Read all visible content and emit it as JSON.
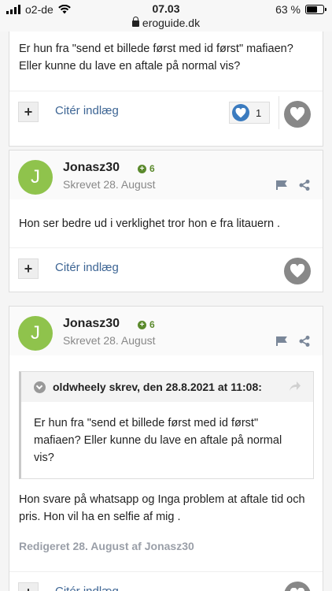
{
  "status_bar": {
    "carrier": "o2-de",
    "time": "07.03",
    "url": "eroguide.dk",
    "battery": "63 %",
    "battery_level": 0.63
  },
  "posts": [
    {
      "body": "Er hun fra \"send et billede først med id først\" mafiaen? Eller kunne du lave en aftale på normal vis?",
      "cite_label": "Citér indlæg",
      "reaction_count": "1"
    },
    {
      "avatar_letter": "J",
      "author": "Jonasz30",
      "reputation": "6",
      "date": "Skrevet 28. August",
      "body": "Hon ser bedre ud i verklighet tror hon e fra litauern .",
      "cite_label": "Citér indlæg"
    },
    {
      "avatar_letter": "J",
      "author": "Jonasz30",
      "reputation": "6",
      "date": "Skrevet 28. August",
      "quote_header": "oldwheely skrev, den 28.8.2021 at 11:08:",
      "quote_text": "Er hun fra \"send et billede først med id først\" mafiaen? Eller kunne du lave en aftale på normal vis?",
      "body": "Hon svare på whatsapp og Inga problem at aftale tid och pris. Hon vil ha en selfie af mig .",
      "edited": "Redigeret 28. August af Jonasz30",
      "cite_label": "Citér indlæg"
    }
  ],
  "colors": {
    "avatar": "#8fc34c",
    "link": "#3d6594",
    "reputation": "#5b8a2d"
  }
}
